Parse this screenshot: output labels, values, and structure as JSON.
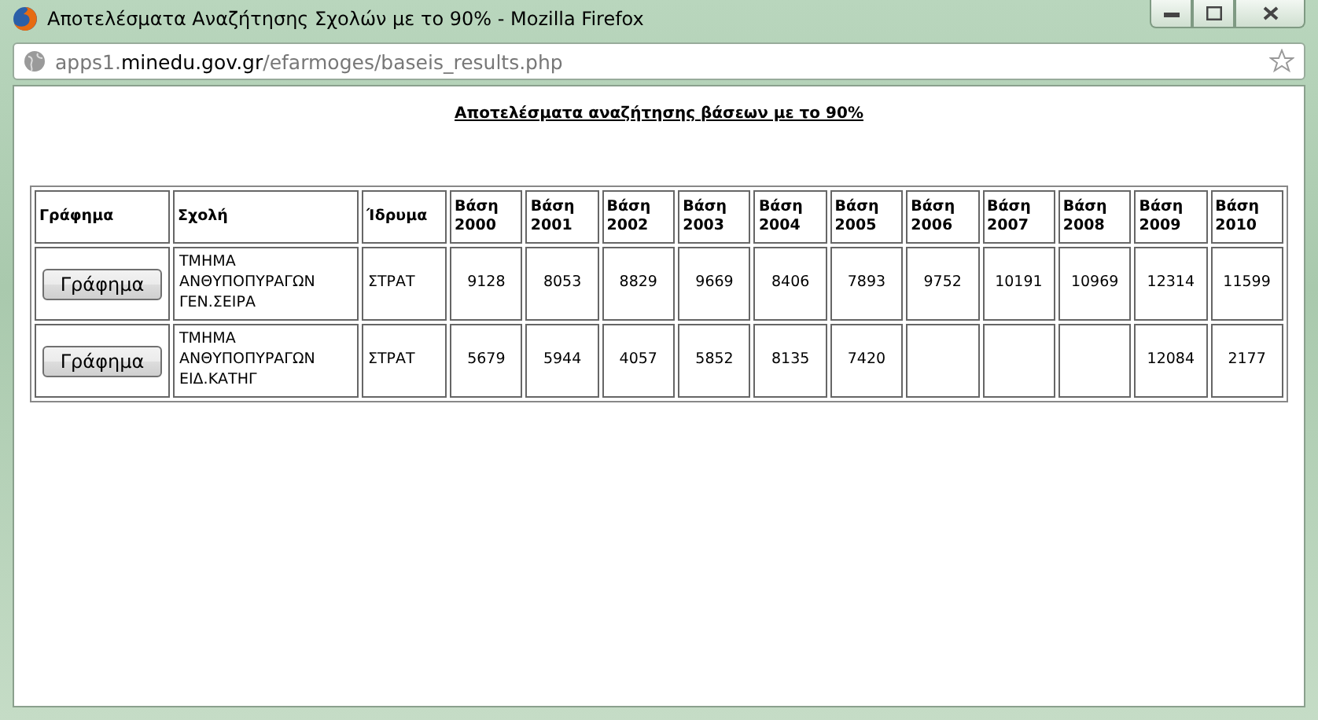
{
  "window": {
    "title": "Αποτελέσματα Αναζήτησης Σχολών με το 90% - Mozilla Firefox"
  },
  "address_bar": {
    "url_start": "apps1.",
    "url_host": "minedu.gov.gr",
    "url_path": "/efarmoges/baseis_results.php"
  },
  "page": {
    "heading": "Αποτελέσματα αναζήτησης βάσεων με το 90%"
  },
  "table": {
    "columns": [
      "Γράφημα",
      "Σχολή",
      "Ίδρυμα",
      "Βάση 2000",
      "Βάση 2001",
      "Βάση 2002",
      "Βάση 2003",
      "Βάση 2004",
      "Βάση 2005",
      "Βάση 2006",
      "Βάση 2007",
      "Βάση 2008",
      "Βάση 2009",
      "Βάση 2010"
    ],
    "rows": [
      {
        "button": "Γράφημα",
        "school": "ΤΜΗΜΑ ΑΝΘΥΠΟΠΥΡΑΓΩΝ ΓΕΝ.ΣΕΙΡΑ",
        "institution": "ΣΤΡΑΤ",
        "values": [
          {
            "text": "9128"
          },
          {
            "text": "8053"
          },
          {
            "text": "8829"
          },
          {
            "text": "9669"
          },
          {
            "text": "8406"
          },
          {
            "text": "7893"
          },
          {
            "text": "9752"
          },
          {
            "text": "10191"
          },
          {
            "text": "10969"
          },
          {
            "text": "12314"
          },
          {
            "text": "11599"
          }
        ]
      },
      {
        "button": "Γράφημα",
        "school": "ΤΜΗΜΑ ΑΝΘΥΠΟΠΥΡΑΓΩΝ ΕΙΔ.ΚΑΤΗΓ",
        "institution": "ΣΤΡΑΤ",
        "values": [
          {
            "text": "5679"
          },
          {
            "text": "5944"
          },
          {
            "text": "4057"
          },
          {
            "text": "5852"
          },
          {
            "text": "8135"
          },
          {
            "text": "7420"
          },
          {
            "blank": true
          },
          {
            "blank": true
          },
          {
            "blank": true
          },
          {
            "text": "12084"
          },
          {
            "text": "2177"
          }
        ]
      }
    ]
  }
}
